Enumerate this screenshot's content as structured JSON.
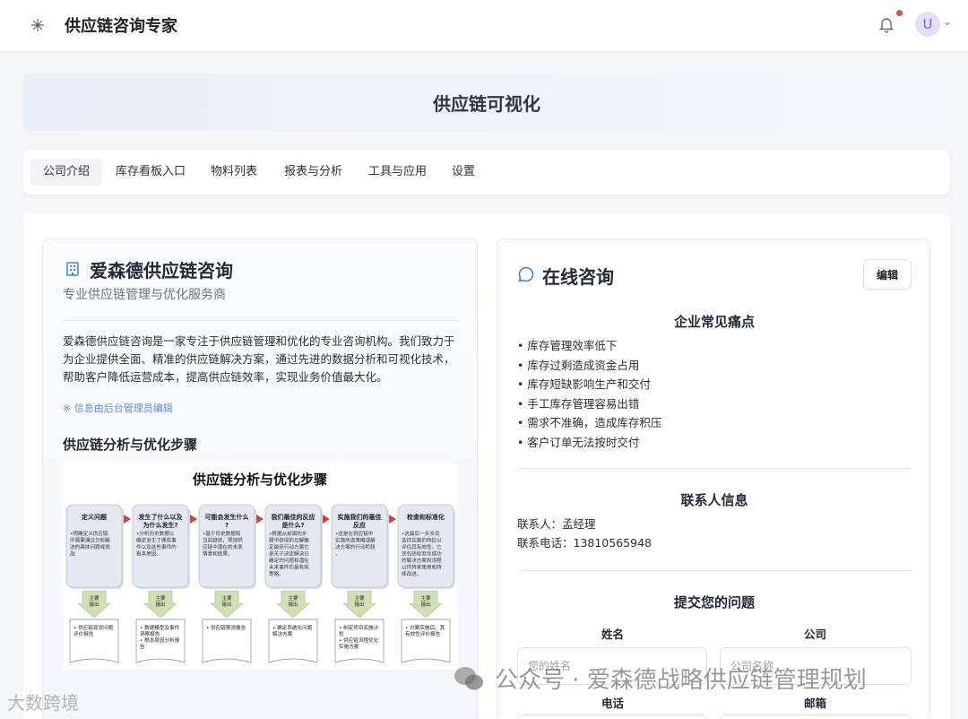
{
  "header": {
    "title": "供应链咨询专家",
    "avatar_letter": "U"
  },
  "hero": {
    "title": "供应链可视化"
  },
  "tabs": [
    {
      "label": "公司介绍"
    },
    {
      "label": "库存看板入口"
    },
    {
      "label": "物料列表"
    },
    {
      "label": "报表与分析"
    },
    {
      "label": "工具与应用"
    },
    {
      "label": "设置"
    }
  ],
  "company": {
    "name": "爱森德供应链咨询",
    "subtitle": "专业供应链管理与优化服务商",
    "description": "爱森德供应链咨询是一家专注于供应链管理和优化的专业咨询机构。我们致力于为企业提供全面、精准的供应链解决方案，通过先进的数据分析和可视化技术，帮助客户降低运营成本，提高供应链效率，实现业务价值最大化。",
    "note": "※ 信息由后台管理员编辑",
    "steps_title": "供应链分析与优化步骤"
  },
  "diagram": {
    "title": "供应链分析与优化步骤",
    "output_label": "主要\n输出",
    "steps": [
      {
        "title": "定义问题",
        "body": "•明确定义供应链中需要通过分析解决的具体问题或挑战",
        "output": "• 供应链现状问题评价报告"
      },
      {
        "title": "发生了什么以及为什么发生?",
        "body": "•分析历史数据以确定发生了哪些事件以及这些事件的根本原因。",
        "output": "• 数据模型及事件洞察报告\n• 根本原因分析报告"
      },
      {
        "title": "可能会发生什么?",
        "body": "•基于历史数据和当前趋势，预测供应链中潜在的未来情景和结果。",
        "output": "• 供应链预测报告"
      },
      {
        "title": "我们最佳的反应是什么?",
        "body": "•根据从前面的步骤中获得的见解确定最佳行动方案它是关于决定解决已确定的问题和潜在未来事件的最有效策略。",
        "output": "• 确定系统化问题解决方案"
      },
      {
        "title": "实施我们的最佳反应",
        "body": "•这是在供应链中实施所选策略或解决方案的行动阶段。",
        "output": "• 制定项目实施计划\n• 供应链流程优化实施方案"
      },
      {
        "title": "检查和标准化",
        "body": "•这最后一步涉及监控实施的响应以评估其有效性。它还包括标准化成功的解决方案和流程以供将来使用和持续改进。",
        "output": "• 方案实施后，其有效性评价报告"
      }
    ]
  },
  "consult": {
    "title": "在线咨询",
    "edit_label": "编辑",
    "pain_title": "企业常见痛点",
    "pains": [
      "• 库存管理效率低下",
      "• 库存过剩造成资金占用",
      "• 库存短缺影响生产和交付",
      "• 手工库存管理容易出错",
      "• 需求不准确，造成库存积压",
      "• 客户订单无法按时交付"
    ],
    "contact_title": "联系人信息",
    "contact_person": "联系人：孟经理",
    "contact_phone": "联系电话：13810565948",
    "form_title": "提交您的问题",
    "name_label": "姓名",
    "company_label": "公司",
    "name_placeholder": "您的姓名",
    "company_placeholder": "公司名称",
    "phone_label": "电话",
    "email_label": "邮箱"
  },
  "watermark": {
    "text": "公众号 · 爱森德战略供应链管理规划",
    "corner": "大数跨境"
  },
  "colors": {
    "accent": "#3b82f6",
    "step_box": "#e3e8f2",
    "arrow": "#c9453b",
    "output_arrow": "#cfe0b3"
  }
}
